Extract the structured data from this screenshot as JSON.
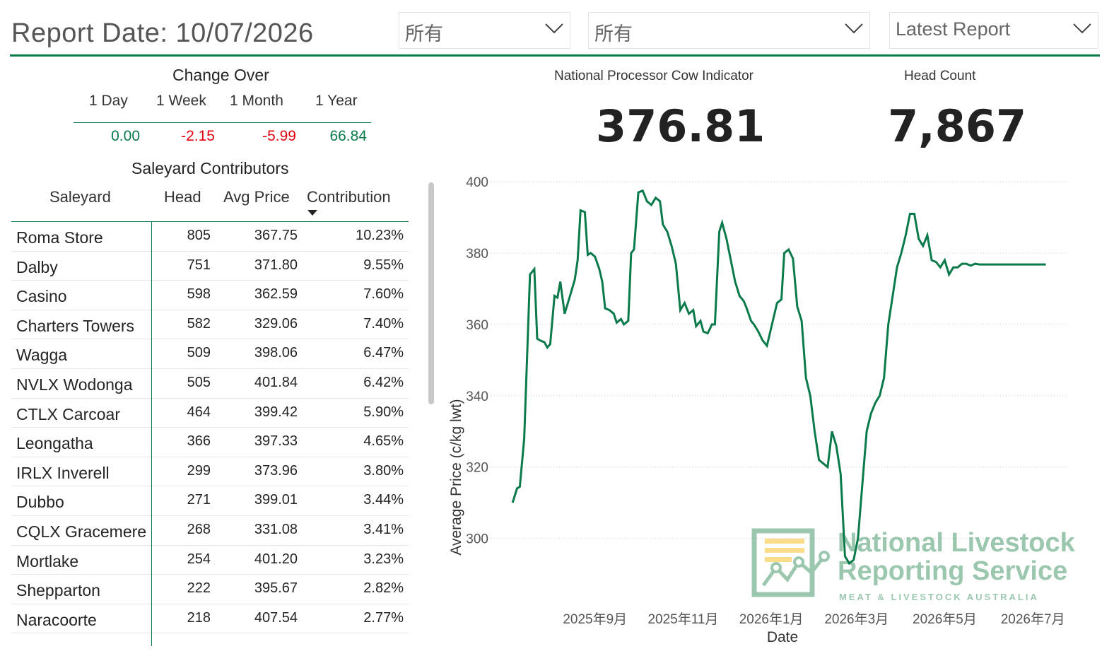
{
  "header": {
    "report_date": "Report Date: 10/07/2026",
    "slicers": [
      {
        "value": "所有"
      },
      {
        "value": "所有"
      },
      {
        "value": "Latest Report"
      }
    ],
    "accent": "#0b7a4a"
  },
  "change_over": {
    "title": "Change Over",
    "headers": [
      "1 Day",
      "1 Week",
      "1 Month",
      "1 Year"
    ],
    "values": [
      "0.00",
      "-2.15",
      "-5.99",
      "66.84"
    ],
    "positive_color": "#0b7a4a",
    "negative_color": "#e3000f"
  },
  "table": {
    "title": "Saleyard Contributors",
    "columns": [
      "Saleyard",
      "Head",
      "Avg Price",
      "Contribution"
    ],
    "sort_column": "Contribution",
    "rows": [
      [
        "Roma Store",
        "805",
        "367.75",
        "10.23%"
      ],
      [
        "Dalby",
        "751",
        "371.80",
        "9.55%"
      ],
      [
        "Casino",
        "598",
        "362.59",
        "7.60%"
      ],
      [
        "Charters Towers",
        "582",
        "329.06",
        "7.40%"
      ],
      [
        "Wagga",
        "509",
        "398.06",
        "6.47%"
      ],
      [
        "NVLX Wodonga",
        "505",
        "401.84",
        "6.42%"
      ],
      [
        "CTLX Carcoar",
        "464",
        "399.42",
        "5.90%"
      ],
      [
        "Leongatha",
        "366",
        "397.33",
        "4.65%"
      ],
      [
        "IRLX Inverell",
        "299",
        "373.96",
        "3.80%"
      ],
      [
        "Dubbo",
        "271",
        "399.01",
        "3.44%"
      ],
      [
        "CQLX Gracemere",
        "268",
        "331.08",
        "3.41%"
      ],
      [
        "Mortlake",
        "254",
        "401.20",
        "3.23%"
      ],
      [
        "Shepparton",
        "222",
        "395.67",
        "2.82%"
      ],
      [
        "Naracoorte",
        "218",
        "407.54",
        "2.77%"
      ]
    ]
  },
  "kpis": [
    {
      "label": "National Processor Cow Indicator",
      "value": "376.81"
    },
    {
      "label": "Head Count",
      "value": "7,867"
    }
  ],
  "watermark": {
    "line1": "National Livestock",
    "line2": "Reporting Service",
    "line3": "MEAT & LIVESTOCK AUSTRALIA"
  },
  "chart_data": {
    "type": "line",
    "ylabel": "Average Price (c/kg lwt)",
    "xlabel": "Date",
    "ylim": [
      292,
      402
    ],
    "y_ticks": [
      300,
      320,
      340,
      360,
      380,
      400
    ],
    "x_ticks": [
      "2025年9月",
      "2025年11月",
      "2026年1月",
      "2026年3月",
      "2026年5月",
      "2026年7月"
    ],
    "x_tick_dates": [
      "2025-09-01",
      "2025-11-01",
      "2026-01-01",
      "2026-03-01",
      "2026-05-01",
      "2026-07-01"
    ],
    "grid": "horizontal dotted",
    "color": "#0b7a4a",
    "series": [
      {
        "x": [
          "2025-07-06",
          "2025-07-09",
          "2025-07-11",
          "2025-07-14",
          "2025-07-18",
          "2025-07-21",
          "2025-07-23",
          "2025-07-25",
          "2025-07-28",
          "2025-07-30",
          "2025-08-01",
          "2025-08-04",
          "2025-08-06",
          "2025-08-08",
          "2025-08-11",
          "2025-08-14",
          "2025-08-18",
          "2025-08-20",
          "2025-08-22",
          "2025-08-25",
          "2025-08-27",
          "2025-08-29",
          "2025-09-01",
          "2025-09-04",
          "2025-09-06",
          "2025-09-08",
          "2025-09-11",
          "2025-09-14",
          "2025-09-16",
          "2025-09-19",
          "2025-09-21",
          "2025-09-24",
          "2025-09-26",
          "2025-09-28",
          "2025-10-01",
          "2025-10-04",
          "2025-10-07",
          "2025-10-10",
          "2025-10-13",
          "2025-10-16",
          "2025-10-18",
          "2025-10-21",
          "2025-10-24",
          "2025-10-27",
          "2025-10-30",
          "2025-11-02",
          "2025-11-05",
          "2025-11-08",
          "2025-11-10",
          "2025-11-13",
          "2025-11-15",
          "2025-11-18",
          "2025-11-21",
          "2025-11-23",
          "2025-11-26",
          "2025-11-28",
          "2025-12-01",
          "2025-12-04",
          "2025-12-07",
          "2025-12-10",
          "2025-12-13",
          "2025-12-15",
          "2025-12-18",
          "2025-12-20",
          "2025-12-23",
          "2025-12-26",
          "2025-12-29",
          "2026-01-05",
          "2026-01-08",
          "2026-01-10",
          "2026-01-13",
          "2026-01-16",
          "2026-01-19",
          "2026-01-22",
          "2026-01-25",
          "2026-01-28",
          "2026-01-31",
          "2026-02-03",
          "2026-02-06",
          "2026-02-09",
          "2026-02-12",
          "2026-02-15",
          "2026-02-18",
          "2026-02-21",
          "2026-02-24",
          "2026-02-27",
          "2026-03-02",
          "2026-03-05",
          "2026-03-08",
          "2026-03-11",
          "2026-03-14",
          "2026-03-17",
          "2026-03-20",
          "2026-03-23",
          "2026-03-26",
          "2026-03-29",
          "2026-04-01",
          "2026-04-04",
          "2026-04-07",
          "2026-04-10",
          "2026-04-13",
          "2026-04-16",
          "2026-04-19",
          "2026-04-22",
          "2026-04-25",
          "2026-04-28",
          "2026-05-01",
          "2026-05-04",
          "2026-05-07",
          "2026-05-10",
          "2026-05-13",
          "2026-05-16",
          "2026-05-19",
          "2026-05-22",
          "2026-05-25",
          "2026-05-28",
          "2026-05-31",
          "2026-06-03",
          "2026-06-06",
          "2026-06-09",
          "2026-06-12",
          "2026-06-15",
          "2026-06-18",
          "2026-06-21",
          "2026-06-24",
          "2026-06-27",
          "2026-06-30",
          "2026-07-03",
          "2026-07-06",
          "2026-07-10"
        ],
        "y": [
          310.0,
          314.0,
          314.5,
          328.0,
          374.0,
          375.5,
          356.0,
          355.5,
          355.0,
          353.5,
          354.5,
          368.0,
          367.5,
          372.0,
          363.0,
          367.0,
          372.5,
          378.0,
          392.0,
          391.5,
          379.5,
          380.0,
          379.0,
          375.5,
          372.0,
          364.5,
          364.0,
          363.0,
          360.5,
          361.5,
          360.0,
          361.0,
          380.0,
          381.0,
          397.0,
          397.5,
          394.5,
          393.5,
          395.5,
          394.5,
          388.0,
          386.0,
          382.0,
          377.0,
          364.0,
          366.0,
          363.0,
          364.0,
          359.5,
          361.0,
          358.0,
          357.5,
          360.0,
          360.0,
          386.0,
          388.5,
          384.0,
          378.0,
          372.0,
          368.0,
          366.5,
          364.5,
          361.0,
          360.0,
          358.0,
          355.5,
          354.0,
          366.0,
          367.0,
          380.0,
          381.0,
          378.5,
          365.0,
          361.0,
          345.0,
          340.0,
          330.0,
          322.0,
          321.0,
          320.0,
          330.0,
          326.0,
          318.0,
          295.0,
          293.0,
          294.0,
          300.0,
          315.0,
          330.0,
          335.0,
          338.0,
          340.0,
          345.0,
          360.0,
          368.0,
          376.0,
          380.0,
          385.0,
          391.0,
          391.0,
          384.0,
          382.0,
          385.0,
          378.0,
          377.5,
          376.0,
          378.0,
          374.0,
          376.0,
          376.0,
          377.0,
          377.0,
          376.5,
          377.0,
          376.8,
          376.8,
          376.8,
          376.8,
          376.8,
          376.8,
          376.8,
          376.8,
          376.8,
          376.8,
          376.8,
          376.8,
          376.8,
          376.8,
          376.8,
          376.8
        ]
      }
    ]
  }
}
